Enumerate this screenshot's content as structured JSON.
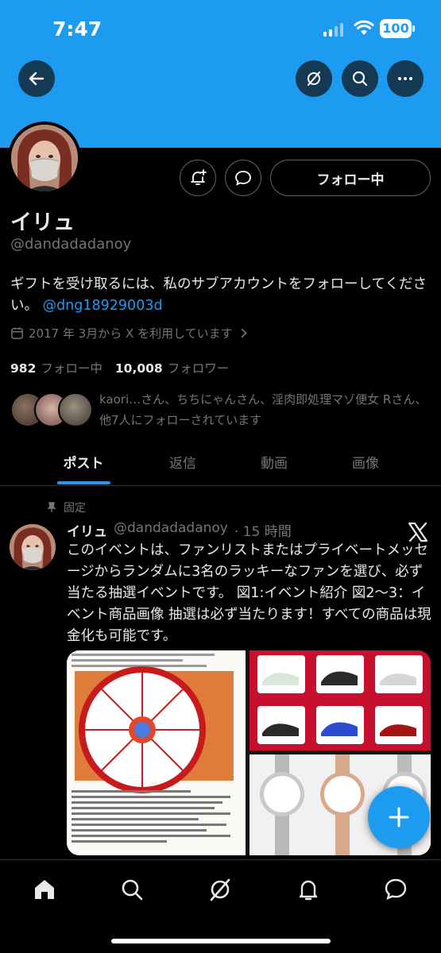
{
  "status_bar": {
    "time": "7:47",
    "battery": "100"
  },
  "profile": {
    "name": "イリュ",
    "handle": "@dandadadanoy",
    "bio_text": "ギフトを受け取るには、私のサブアカウントをフォローしてください。",
    "bio_link": "@dng18929003d",
    "joined": "2017 年 3月から X を利用しています",
    "following_count": "982",
    "following_label": "フォロー中",
    "followers_count": "10,008",
    "followers_label": "フォロワー",
    "followed_by": "kaori…さん、ちちにゃんさん、淫肉即処理マゾ便女 Rさん、他7人にフォローされています",
    "follow_button": "フォロー中"
  },
  "tabs": [
    {
      "label": "ポスト",
      "active": true
    },
    {
      "label": "返信",
      "active": false
    },
    {
      "label": "動画",
      "active": false
    },
    {
      "label": "画像",
      "active": false
    }
  ],
  "post": {
    "pinned_label": "固定",
    "author_name": "イリュ",
    "author_handle": "@dandadadanoy",
    "time": "· 15 時間",
    "text": "このイベントは、ファンリストまたはプライベートメッセージからランダムに3名のラッキーなファンを選び、必ず当たる抽選イベントです。 図1:イベント紹介 図2〜3：イベント商品画像 抽選は必ず当たります！すべての商品は現金化も可能です。"
  },
  "colors": {
    "accent": "#1d9bf0",
    "background": "#000000",
    "muted": "#71767b",
    "text": "#e7e9ea"
  },
  "icons": {
    "header": [
      "back-arrow-icon",
      "grok-icon",
      "search-icon",
      "more-icon"
    ],
    "actions": [
      "notification-bell-plus-icon",
      "message-icon"
    ],
    "nav": [
      "home-icon",
      "search-icon",
      "grok-icon",
      "notifications-icon",
      "messages-icon"
    ],
    "fab": "plus-icon"
  }
}
